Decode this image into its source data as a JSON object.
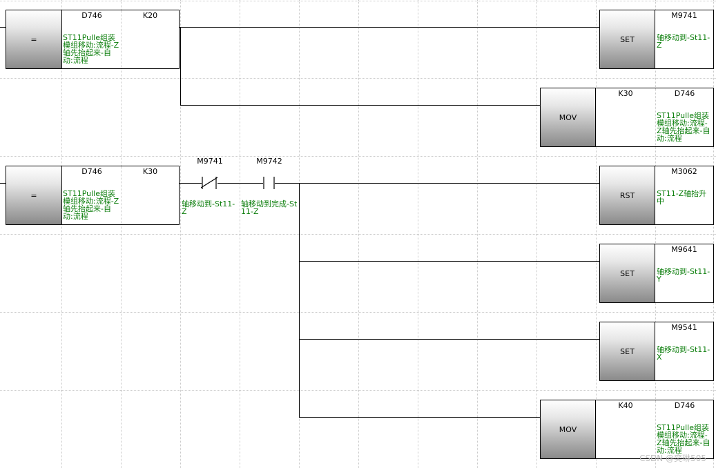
{
  "rungs": {
    "r1": {
      "compare": {
        "op": "=",
        "src1": "D746",
        "src2": "K20",
        "comment": "ST11Pulle组装模组移动:流程-Z轴先抬起来-自动:流程"
      },
      "set1": {
        "op": "SET",
        "device": "M9741",
        "comment": "轴移动到-St11-Z"
      },
      "mov1": {
        "op": "MOV",
        "src": "K30",
        "dst": "D746",
        "comment": "ST11Pulle组装模组移动:流程-Z轴先抬起来-自动:流程"
      }
    },
    "r2": {
      "compare": {
        "op": "=",
        "src1": "D746",
        "src2": "K30",
        "comment": "ST11Pulle组装模组移动:流程-Z轴先抬起来-自动:流程"
      },
      "contact1": {
        "device": "M9741",
        "comment": "轴移动到-St11-Z"
      },
      "contact2": {
        "device": "M9742",
        "comment": "轴移动到完成-St11-Z"
      },
      "rst1": {
        "op": "RST",
        "device": "M3062",
        "comment": "ST11-Z轴抬升中"
      },
      "set2": {
        "op": "SET",
        "device": "M9641",
        "comment": "轴移动到-St11-Y"
      },
      "set3": {
        "op": "SET",
        "device": "M9541",
        "comment": "轴移动到-St11-X"
      },
      "mov2": {
        "op": "MOV",
        "src": "K40",
        "dst": "D746",
        "comment": "ST11Pulle组装模组移动:流程-Z轴先抬起来-自动:流程"
      }
    }
  },
  "watermark": "CSDN @奕琳505"
}
